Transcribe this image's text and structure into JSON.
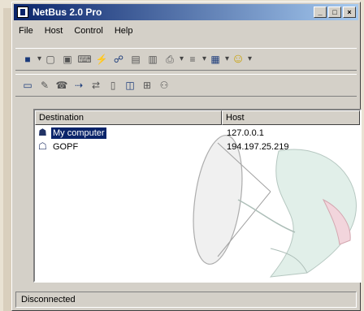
{
  "window": {
    "title": "NetBus 2.0 Pro"
  },
  "menu": [
    "File",
    "Host",
    "Control",
    "Help"
  ],
  "toolbar1": [
    {
      "icon": "host-icon"
    },
    {
      "icon": "sep"
    },
    {
      "icon": "screen-icon"
    },
    {
      "icon": "window-icon"
    },
    {
      "icon": "keyboard-icon"
    },
    {
      "icon": "plug-icon"
    },
    {
      "icon": "network-icon"
    },
    {
      "icon": "file-icon"
    },
    {
      "icon": "folder-icon"
    },
    {
      "icon": "printer-icon"
    },
    {
      "icon": "sep"
    },
    {
      "icon": "list-icon"
    },
    {
      "icon": "sep"
    },
    {
      "icon": "grid-icon"
    },
    {
      "icon": "sep"
    },
    {
      "icon": "smiley-icon"
    }
  ],
  "toolbar2": [
    {
      "icon": "monitor-icon"
    },
    {
      "icon": "edit-icon"
    },
    {
      "icon": "sep"
    },
    {
      "icon": "phone-icon"
    },
    {
      "icon": "arrow-icon"
    },
    {
      "icon": "connect-icon"
    },
    {
      "icon": "document-icon"
    },
    {
      "icon": "sep"
    },
    {
      "icon": "chart-icon"
    },
    {
      "icon": "tree-icon"
    },
    {
      "icon": "people-icon"
    }
  ],
  "list": {
    "columns": {
      "destination": "Destination",
      "host": "Host"
    },
    "rows": [
      {
        "destination": "My computer",
        "host": "127.0.0.1",
        "selected": true,
        "icon": "computer-user-icon"
      },
      {
        "destination": "GOPF",
        "host": "194.197.25.219",
        "selected": false,
        "icon": "computer-network-icon"
      }
    ]
  },
  "status": "Disconnected"
}
